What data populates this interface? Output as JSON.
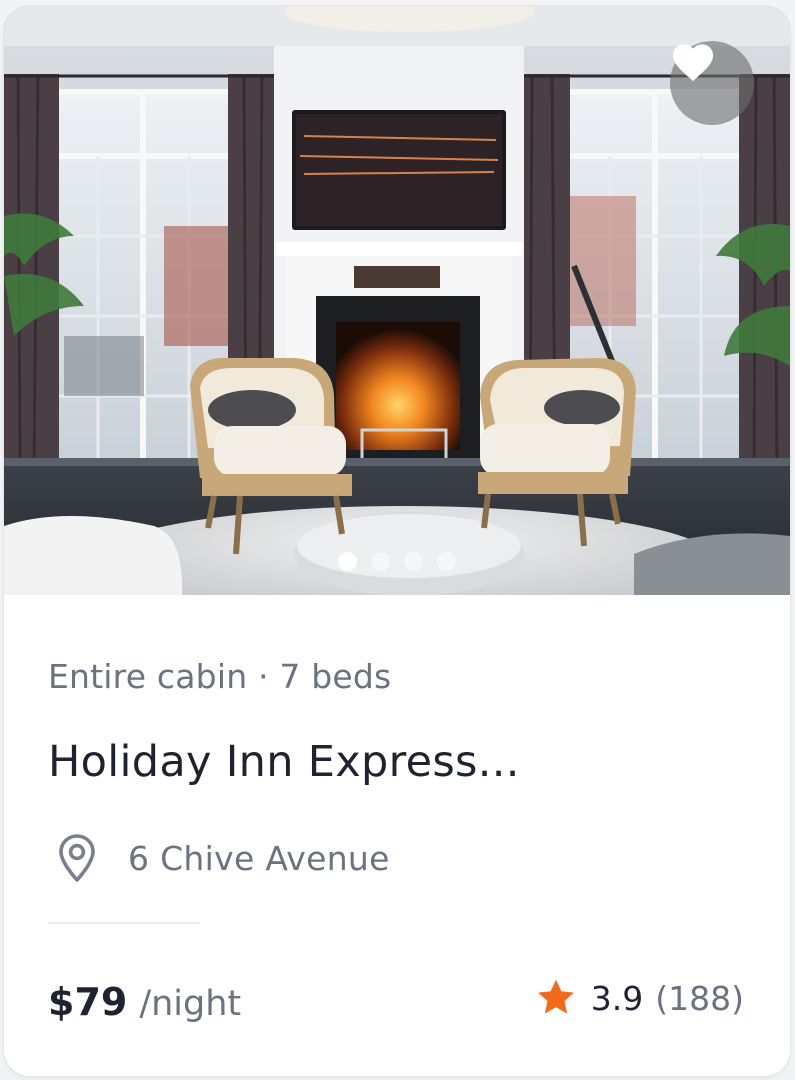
{
  "listing": {
    "type_line": "Entire cabin · 7 beds",
    "title": "Holiday Inn Express...",
    "address": "6 Chive Avenue",
    "price": "$79",
    "price_unit": "/night",
    "rating": "3.9",
    "review_count": "(188)"
  },
  "photo": {
    "description_icon": "photo",
    "total_images": 4,
    "active_index": 1
  },
  "icons": {
    "favorite": "heart-icon",
    "location": "map-pin-icon",
    "rating": "star-icon"
  },
  "colors": {
    "star": "#f26b1d",
    "text_primary": "#1f2230",
    "text_secondary": "#6b7280"
  }
}
